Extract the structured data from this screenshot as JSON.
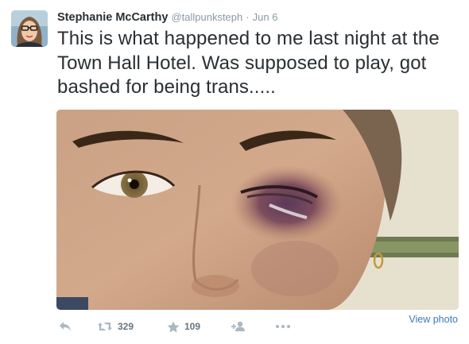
{
  "tweet": {
    "author_name": "Stephanie McCarthy",
    "author_handle": "@tallpunksteph",
    "separator": "·",
    "date": "Jun 6",
    "text": "This is what happened to me last night at the Town Hall Hotel. Was supposed to play, got bashed for being trans.....",
    "retweet_count": "329",
    "favorite_count": "109",
    "view_photo_label": "View photo"
  },
  "icons": {
    "reply": "reply-icon",
    "retweet": "retweet-icon",
    "favorite": "star-icon",
    "follow": "add-user-icon",
    "more": "more-dots-icon"
  },
  "colors": {
    "name": "#292f33",
    "meta": "#8899a6",
    "action_icon": "#aab8c2",
    "link": "#3b79b5"
  }
}
